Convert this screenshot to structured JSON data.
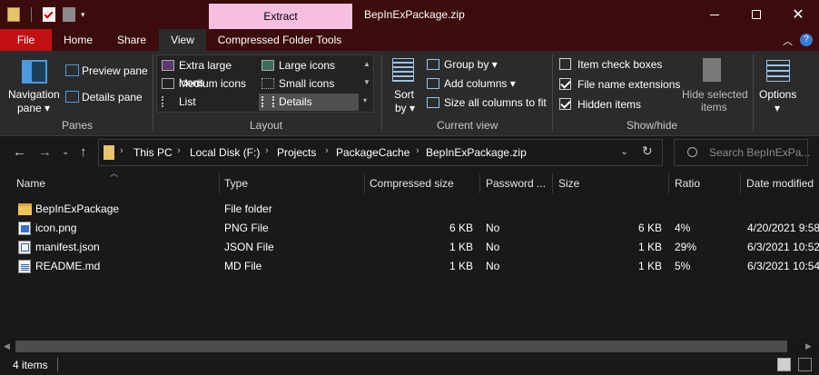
{
  "window": {
    "title": "BepInExPackage.zip",
    "context_tab": "Extract",
    "minimize_icon": "minimize-icon",
    "maximize_icon": "maximize-icon",
    "close_icon": "close-icon"
  },
  "tabs": {
    "file": "File",
    "home": "Home",
    "share": "Share",
    "view": "View",
    "compressed": "Compressed Folder Tools"
  },
  "ribbon": {
    "panes": {
      "navigation_pane": "Navigation",
      "navigation_pane2": "pane",
      "preview_pane": "Preview pane",
      "details_pane": "Details pane",
      "group_label": "Panes"
    },
    "layout": {
      "extra_large": "Extra large icons",
      "large": "Large icons",
      "medium": "Medium icons",
      "small": "Small icons",
      "list": "List",
      "details": "Details",
      "group_label": "Layout"
    },
    "current_view": {
      "sort_by": "Sort",
      "sort_by2": "by",
      "group_by": "Group by",
      "add_columns": "Add columns",
      "size_all": "Size all columns to fit",
      "group_label": "Current view"
    },
    "show_hide": {
      "item_check_boxes": "Item check boxes",
      "item_check_boxes_checked": false,
      "file_name_extensions": "File name extensions",
      "file_name_extensions_checked": true,
      "hidden_items": "Hidden items",
      "hidden_items_checked": true,
      "hide_selected": "Hide selected",
      "hide_selected2": "items",
      "group_label": "Show/hide"
    },
    "options": "Options"
  },
  "address": {
    "crumbs": [
      "This PC",
      "Local Disk (F:)",
      "Projects",
      "PackageCache",
      "BepInExPackage.zip"
    ],
    "search_placeholder": "Search BepInExPa..."
  },
  "columns": {
    "name": "Name",
    "type": "Type",
    "compressed_size": "Compressed size",
    "password": "Password ...",
    "size": "Size",
    "ratio": "Ratio",
    "date_modified": "Date modified"
  },
  "files": [
    {
      "name": "BepInExPackage",
      "type": "File folder",
      "compressed": "",
      "password": "",
      "size": "",
      "ratio": "",
      "date": "",
      "icon": "folder-icon"
    },
    {
      "name": "icon.png",
      "type": "PNG File",
      "compressed": "6 KB",
      "password": "No",
      "size": "6 KB",
      "ratio": "4%",
      "date": "4/20/2021 9:58",
      "icon": "image-file-icon"
    },
    {
      "name": "manifest.json",
      "type": "JSON File",
      "compressed": "1 KB",
      "password": "No",
      "size": "1 KB",
      "ratio": "29%",
      "date": "6/3/2021 10:52",
      "icon": "json-file-icon"
    },
    {
      "name": "README.md",
      "type": "MD File",
      "compressed": "1 KB",
      "password": "No",
      "size": "1 KB",
      "ratio": "5%",
      "date": "6/3/2021 10:54",
      "icon": "text-file-icon"
    }
  ],
  "status": {
    "item_count": "4 items"
  },
  "colors": {
    "titlebar": "#3c0b0b",
    "file_tab": "#c20f12",
    "context_tab": "#f6bfe0",
    "ribbon": "#2b2b2b",
    "background": "#191919"
  }
}
